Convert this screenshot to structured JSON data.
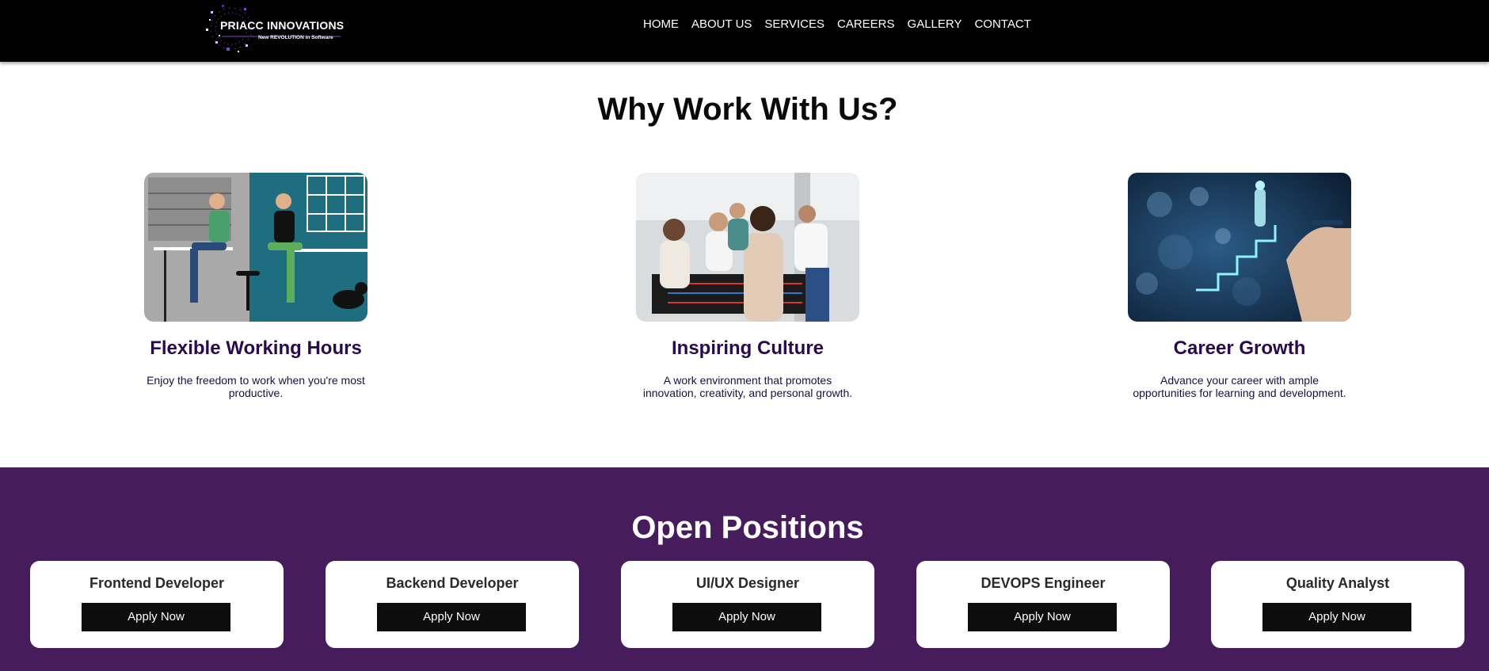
{
  "header": {
    "logo": {
      "title": "PRIACC INNOVATIONS",
      "tagline": "New REVOLUTION in Software"
    },
    "nav": [
      "HOME",
      "ABOUT US",
      "SERVICES",
      "CAREERS",
      "GALLERY",
      "CONTACT"
    ]
  },
  "why": {
    "title": "Why Work With Us?",
    "features": [
      {
        "title": "Flexible Working Hours",
        "desc": "Enjoy the freedom to work when you're most productive."
      },
      {
        "title": "Inspiring Culture",
        "desc": "A work environment that promotes innovation, creativity, and personal growth."
      },
      {
        "title": "Career Growth",
        "desc": "Advance your career with ample opportunities for learning and development."
      }
    ]
  },
  "positions": {
    "title": "Open Positions",
    "jobs": [
      {
        "title": "Frontend Developer",
        "button": "Apply Now"
      },
      {
        "title": "Backend Developer",
        "button": "Apply Now"
      },
      {
        "title": "UI/UX Designer",
        "button": "Apply Now"
      },
      {
        "title": "DEVOPS Engineer",
        "button": "Apply Now"
      },
      {
        "title": "Quality Analyst",
        "button": "Apply Now"
      }
    ]
  },
  "colors": {
    "header_bg": "#000000",
    "accent_purple": "#461c5c",
    "feature_title": "#2a0a4e",
    "button_bg": "#0d0d0d"
  }
}
